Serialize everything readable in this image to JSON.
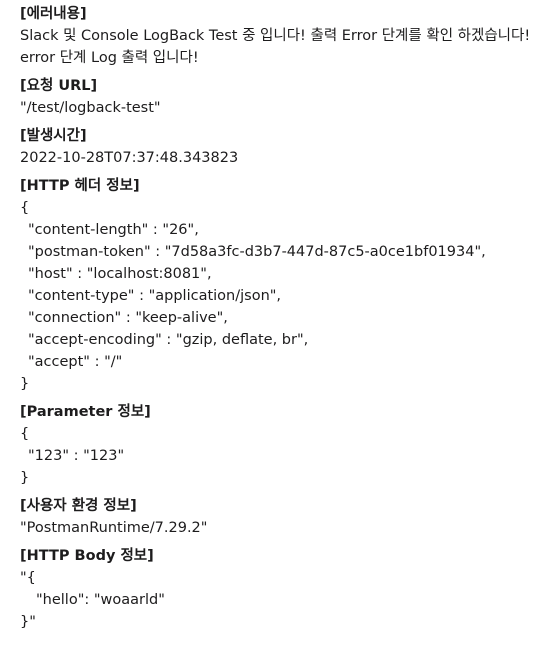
{
  "sections": {
    "error": {
      "heading": "[에러내용]",
      "lines": [
        "Slack 및 Console LogBack Test 중 입니다! 출력 Error 단계를 확인 하겠습니다!",
        "error 단계 Log 출력 입니다!"
      ]
    },
    "url": {
      "heading": "[요청 URL]",
      "value": "\"/test/logback-test\""
    },
    "time": {
      "heading": "[발생시간]",
      "value": "2022-10-28T07:37:48.343823"
    },
    "headers": {
      "heading": "[HTTP 헤더 정보]",
      "open": "{",
      "lines": [
        "\"content-length\" : \"26\",",
        "\"postman-token\" : \"7d58a3fc-d3b7-447d-87c5-a0ce1bf01934\",",
        "\"host\" : \"localhost:8081\",",
        "\"content-type\" : \"application/json\",",
        "\"connection\" : \"keep-alive\",",
        "\"accept-encoding\" : \"gzip, deflate, br\",",
        "\"accept\" : \"/\""
      ],
      "close": "}"
    },
    "params": {
      "heading": "[Parameter 정보]",
      "open": "{",
      "lines": [
        "\"123\" : \"123\""
      ],
      "close": "}"
    },
    "agent": {
      "heading": "[사용자 환경 정보]",
      "value": "\"PostmanRuntime/7.29.2\""
    },
    "body": {
      "heading": "[HTTP Body 정보]",
      "open": "\"{",
      "line": "\"hello\": \"woaarld\"",
      "close": "}\""
    }
  }
}
